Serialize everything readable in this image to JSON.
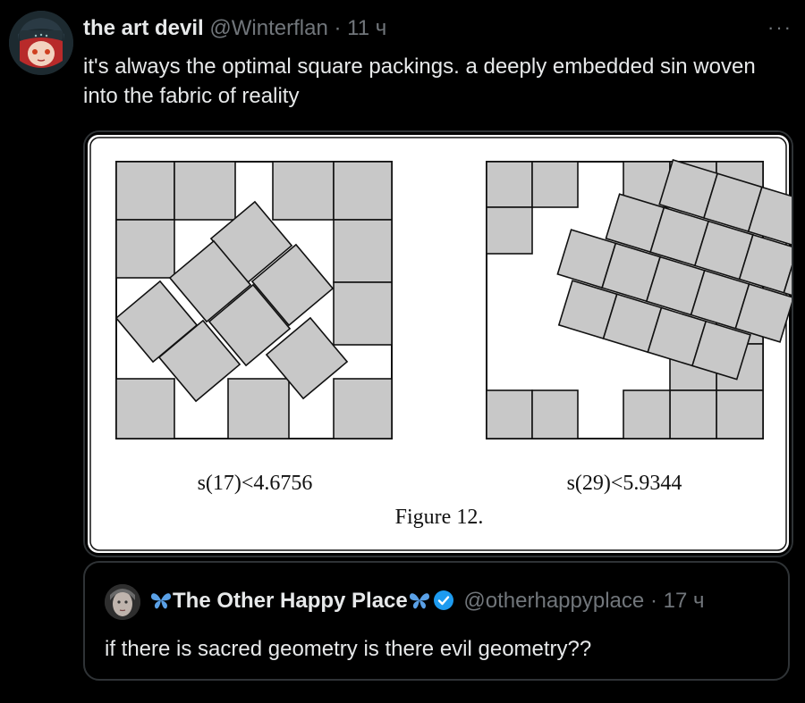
{
  "tweet": {
    "author_name": "the art devil",
    "author_handle": "@Winterflan",
    "separator": "·",
    "time": "11 ч",
    "more_label": "···",
    "text": "it's always the optimal square packings. a deeply embedded sin woven into the fabric of reality"
  },
  "figure": {
    "left_caption": "s(17)<4.6756",
    "right_caption": "s(29)<5.9344",
    "title": "Figure 12."
  },
  "quote": {
    "author_name": "The Other Happy Place",
    "author_handle": "@otherhappyplace",
    "separator": "·",
    "time": "17 ч",
    "text": "if there is sacred geometry is there evil geometry??"
  },
  "colors": {
    "background": "#000000",
    "text": "#e7e9ea",
    "muted": "#71767b",
    "border": "#2f3336",
    "verified": "#1d9bf0",
    "butterfly": "#5aa0e6",
    "square_fill": "#c8c8c8"
  },
  "icons": {
    "more": "more-horizontal-icon",
    "verified": "verified-badge-icon",
    "butterfly": "butterfly-icon"
  }
}
